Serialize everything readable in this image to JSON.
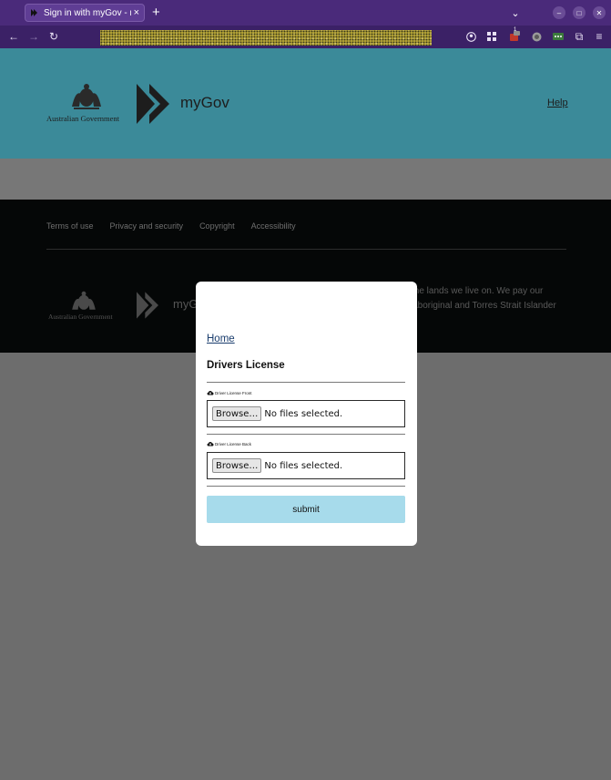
{
  "browser": {
    "tab_title": "Sign in with myGov - myG",
    "tab_close": "×",
    "new_tab": "+",
    "ext_badge": "1",
    "icons": [
      "back-icon",
      "forward-icon",
      "reload-icon",
      "account-icon",
      "extensions-grid-icon",
      "shield-extension-icon",
      "privacy-extension-icon",
      "password-extension-icon",
      "puzzle-icon",
      "menu-icon"
    ]
  },
  "header": {
    "gov_text": "Australian Government",
    "brand": "myGov",
    "help_label": "Help"
  },
  "footer": {
    "links": [
      "Terms of use",
      "Privacy and security",
      "Copyright",
      "Accessibility"
    ],
    "gov_text": "Australian Government",
    "brand_partial": "myG",
    "acknowledgement": "the lands we live on. We pay our\nAboriginal and Torres Strait Islander"
  },
  "modal": {
    "home_link": "Home",
    "title": "Drivers License",
    "front": {
      "label": "Driver License Front",
      "button": "Browse…",
      "status": "No files selected."
    },
    "back": {
      "label": "Driver License Back",
      "button": "Browse…",
      "status": "No files selected."
    },
    "submit_label": "submit"
  },
  "colors": {
    "titlebar": "#4a2a7a",
    "header": "#3b8a99",
    "footer": "#050707",
    "overlay": "#6d6d6d",
    "submit": "#a7dbeb"
  }
}
